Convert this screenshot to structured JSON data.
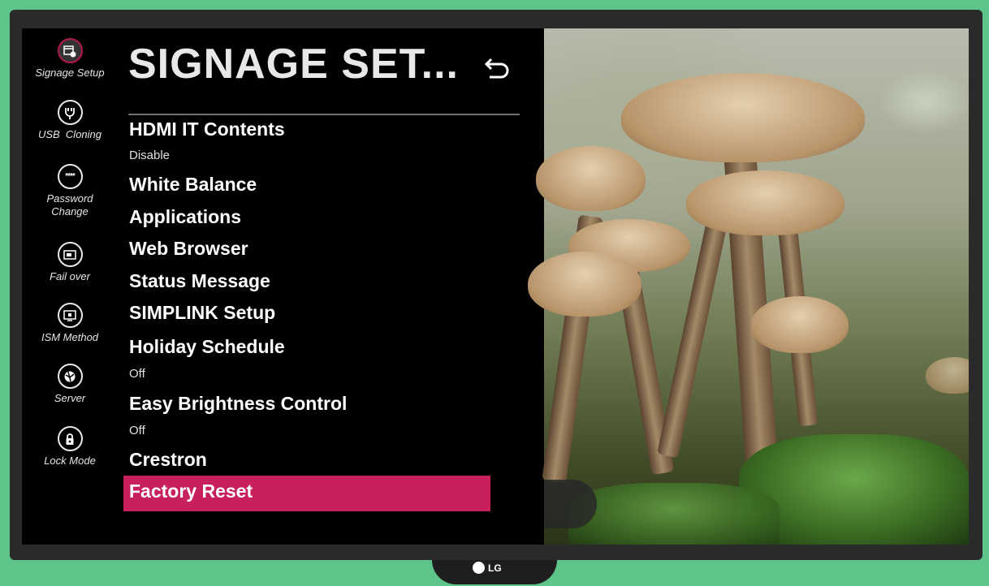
{
  "screen": {
    "title": "SIGNAGE SET...",
    "back_icon": "back-arrow-icon"
  },
  "sidebar": {
    "items": [
      {
        "label": "Signage Setup",
        "icon": "calendar-gear-icon",
        "active": true
      },
      {
        "label": "USB  Cloning",
        "icon": "usb-icon"
      },
      {
        "label": "Password Change",
        "icon": "password-dots-icon"
      },
      {
        "label": "Fail over",
        "icon": "failover-icon"
      },
      {
        "label": "ISM Method",
        "icon": "ism-screen-icon"
      },
      {
        "label": "Server",
        "icon": "server-globe-icon"
      },
      {
        "label": "Lock Mode",
        "icon": "lock-icon"
      }
    ]
  },
  "menu": {
    "items": [
      {
        "label": "HDMI IT Contents",
        "value": "Disable"
      },
      {
        "label": "White Balance"
      },
      {
        "label": "Applications"
      },
      {
        "label": "Web Browser"
      },
      {
        "label": "Status Message"
      },
      {
        "label": "SIMPLINK Setup"
      },
      {
        "label": "Holiday Schedule",
        "value": "Off"
      },
      {
        "label": "Easy Brightness Control",
        "value": "Off"
      },
      {
        "label": "Crestron"
      },
      {
        "label": "Factory Reset",
        "selected": true
      }
    ]
  },
  "brand": {
    "logo_text": "LG"
  },
  "colors": {
    "accent": "#c81f5d",
    "background": "#000000",
    "bezel": "#2a2a2a",
    "wall": "#5fc48a"
  }
}
